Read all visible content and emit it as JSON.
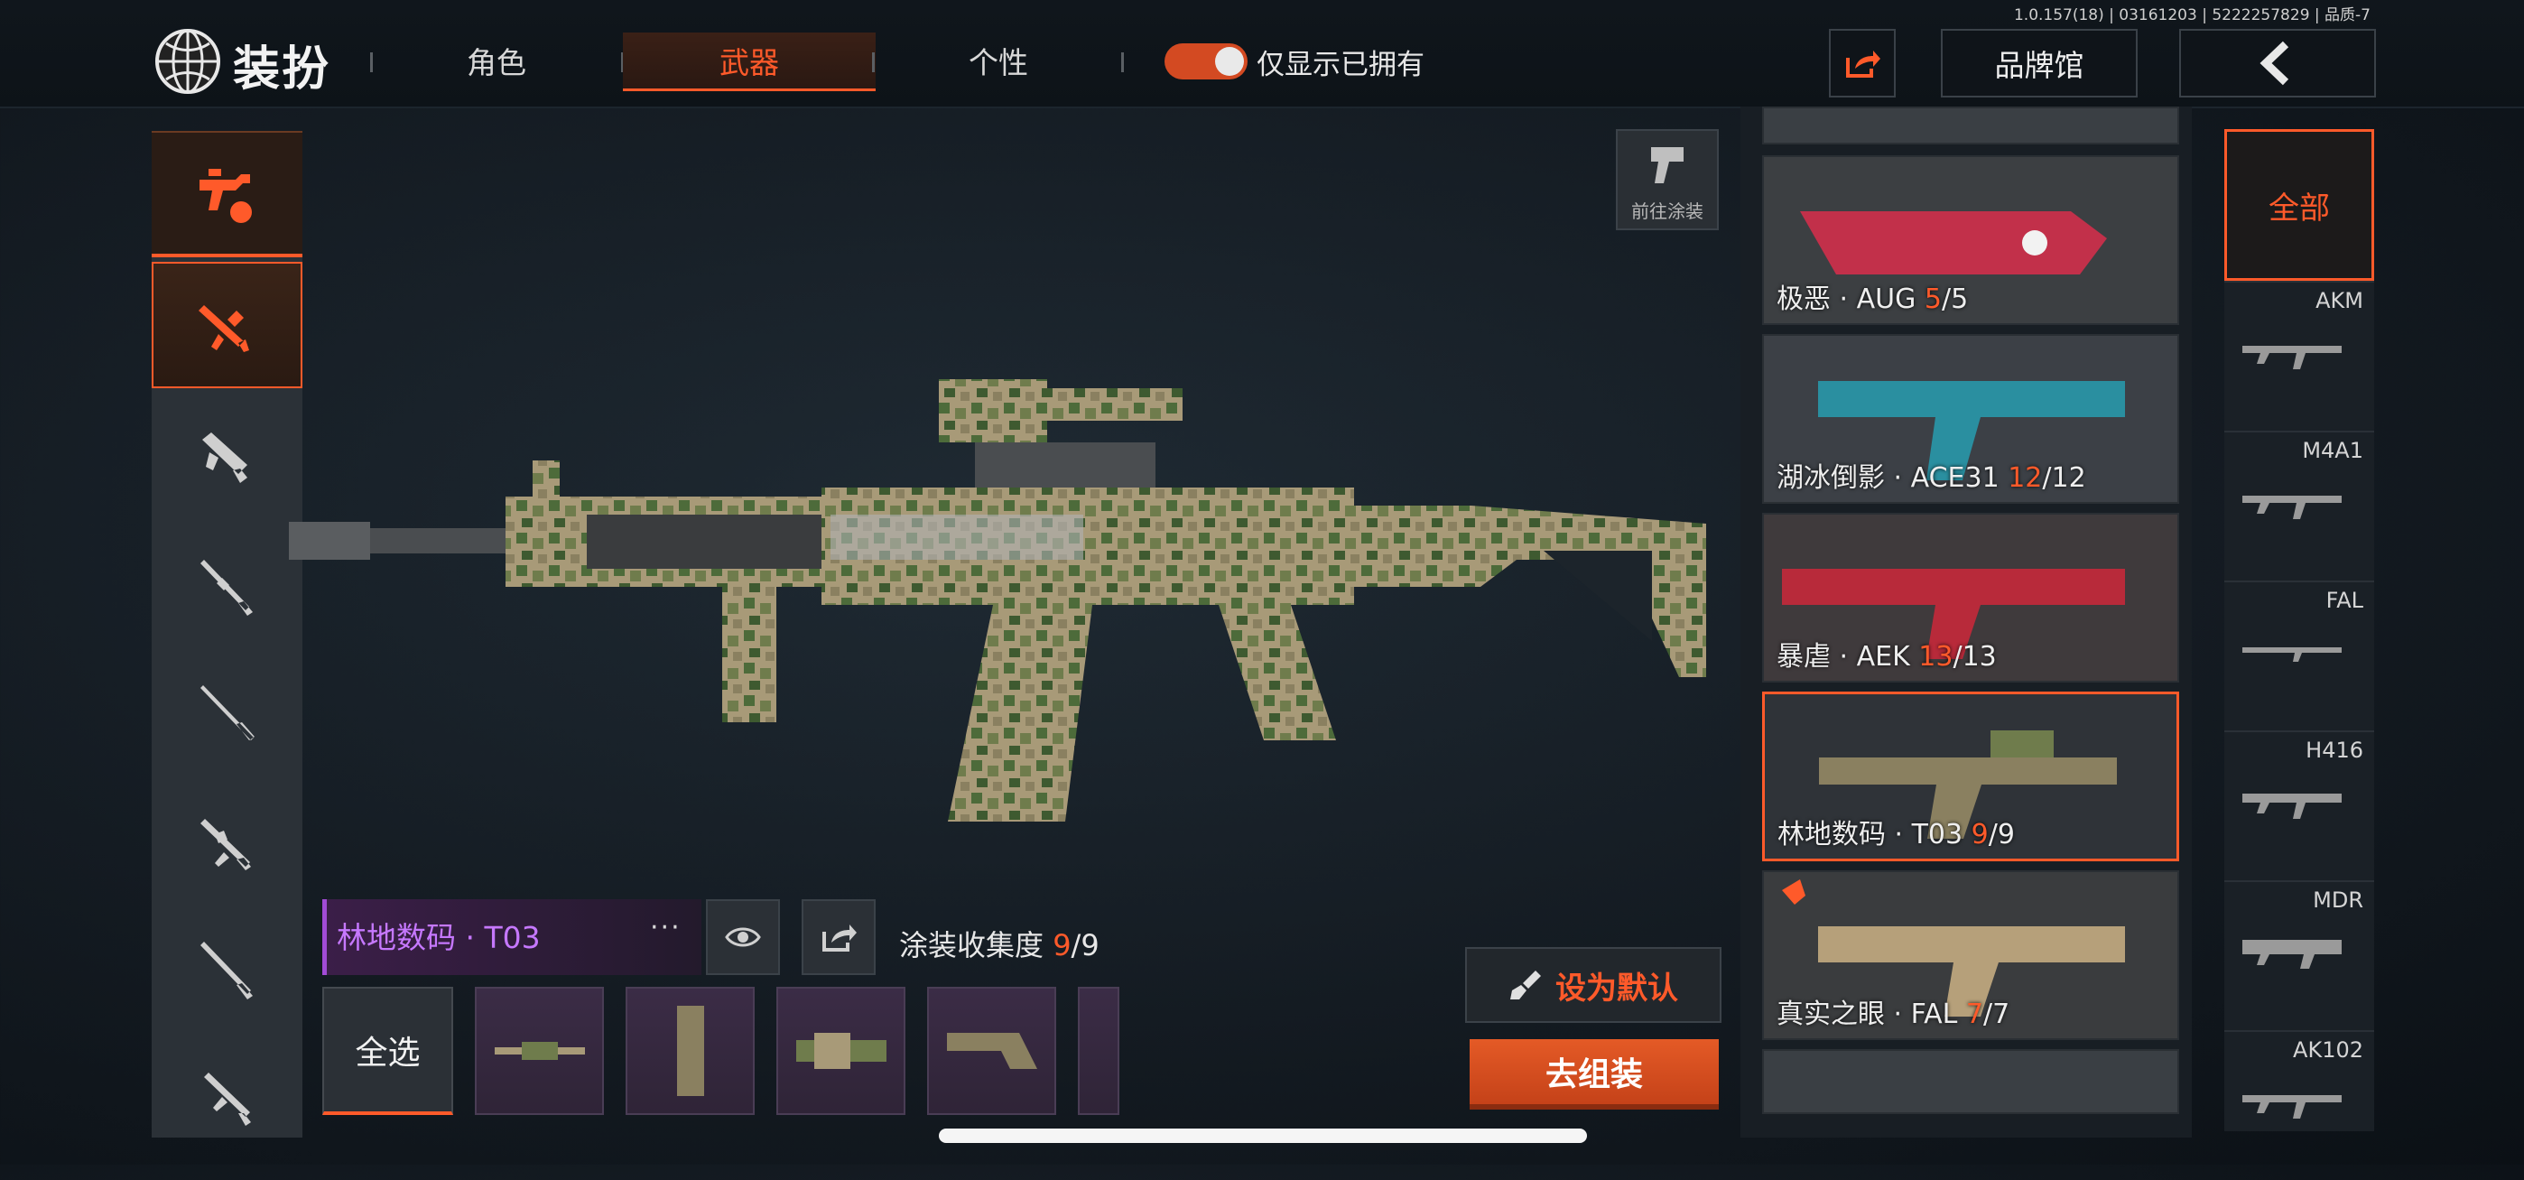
{
  "version": "1.0.157(18) | 03161203 | 5222257829 | 品质-7",
  "header": {
    "title": "装扮",
    "tabs": [
      {
        "label": "角色",
        "active": false
      },
      {
        "label": "武器",
        "active": true
      },
      {
        "label": "个性",
        "active": false
      }
    ],
    "toggle_label": "仅显示已拥有",
    "toggle_on": true,
    "brand_label": "品牌馆"
  },
  "colors": {
    "accent": "#ff5a2a",
    "rare_purple": "#c678ff"
  },
  "left_categories": [
    "all-weapons-icon",
    "rifle-icon",
    "smg-icon",
    "shotgun-icon",
    "sniper-icon",
    "lmg-icon",
    "marksman-icon",
    "pistol-icon"
  ],
  "goto_paint_label": "前往涂装",
  "current_skin": {
    "name": "林地数码 · T03",
    "more": "···",
    "collection_label": "涂装收集度",
    "owned": "9",
    "total": "/9"
  },
  "parts": {
    "select_all": "全选"
  },
  "actions": {
    "set_default": "设为默认",
    "go_assemble": "去组装"
  },
  "skins": [
    {
      "name": "极恶 · AUG ",
      "owned": "5",
      "total": "/5",
      "selected": false
    },
    {
      "name": "湖冰倒影 · ACE31 ",
      "owned": "12",
      "total": "/12",
      "selected": false
    },
    {
      "name": "暴虐 · AEK ",
      "owned": "13",
      "total": "/13",
      "selected": false
    },
    {
      "name": "林地数码 · T03 ",
      "owned": "9",
      "total": "/9",
      "selected": true
    },
    {
      "name": "真实之眼 · FAL ",
      "owned": "7",
      "total": "/7",
      "selected": false
    }
  ],
  "weapon_filter": {
    "all_label": "全部",
    "weapons": [
      "AKM",
      "M4A1",
      "FAL",
      "H416",
      "MDR",
      "AK102"
    ]
  }
}
